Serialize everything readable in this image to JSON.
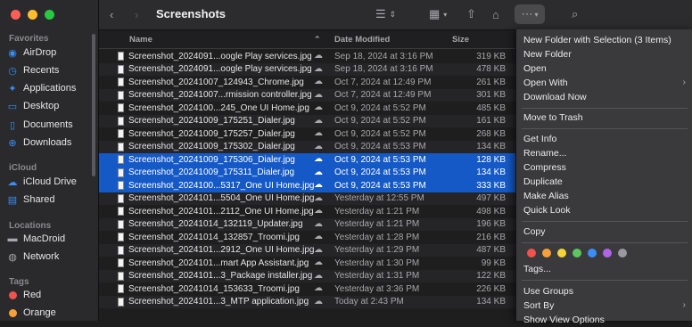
{
  "window": {
    "title": "Screenshots"
  },
  "sidebar": {
    "favorites_label": "Favorites",
    "favorites": [
      "AirDrop",
      "Recents",
      "Applications",
      "Desktop",
      "Documents",
      "Downloads"
    ],
    "icloud_label": "iCloud",
    "icloud": [
      "iCloud Drive",
      "Shared"
    ],
    "locations_label": "Locations",
    "locations": [
      "MacDroid",
      "Network"
    ],
    "tags_label": "Tags",
    "tags": [
      {
        "label": "Red",
        "color": "#f0524f"
      },
      {
        "label": "Orange",
        "color": "#f7a03a"
      }
    ]
  },
  "columns": {
    "name": "Name",
    "date": "Date Modified",
    "size": "Size"
  },
  "files": [
    {
      "name": "Screenshot_2024091...oogle Play services.jpg",
      "date": "Sep 18, 2024 at 3:16 PM",
      "size": "319 KB",
      "selected": false
    },
    {
      "name": "Screenshot_2024091...oogle Play services.jpg",
      "date": "Sep 18, 2024 at 3:16 PM",
      "size": "478 KB",
      "selected": false
    },
    {
      "name": "Screenshot_20241007_124943_Chrome.jpg",
      "date": "Oct 7, 2024 at 12:49 PM",
      "size": "261 KB",
      "selected": false
    },
    {
      "name": "Screenshot_20241007...rmission controller.jpg",
      "date": "Oct 7, 2024 at 12:49 PM",
      "size": "301 KB",
      "selected": false
    },
    {
      "name": "Screenshot_2024100...245_One UI Home.jpg",
      "date": "Oct 9, 2024 at 5:52 PM",
      "size": "485 KB",
      "selected": false
    },
    {
      "name": "Screenshot_20241009_175251_Dialer.jpg",
      "date": "Oct 9, 2024 at 5:52 PM",
      "size": "161 KB",
      "selected": false
    },
    {
      "name": "Screenshot_20241009_175257_Dialer.jpg",
      "date": "Oct 9, 2024 at 5:52 PM",
      "size": "268 KB",
      "selected": false
    },
    {
      "name": "Screenshot_20241009_175302_Dialer.jpg",
      "date": "Oct 9, 2024 at 5:53 PM",
      "size": "134 KB",
      "selected": false
    },
    {
      "name": "Screenshot_20241009_175306_Dialer.jpg",
      "date": "Oct 9, 2024 at 5:53 PM",
      "size": "128 KB",
      "selected": true
    },
    {
      "name": "Screenshot_20241009_175311_Dialer.jpg",
      "date": "Oct 9, 2024 at 5:53 PM",
      "size": "134 KB",
      "selected": true
    },
    {
      "name": "Screenshot_2024100...5317_One UI Home.jpg",
      "date": "Oct 9, 2024 at 5:53 PM",
      "size": "333 KB",
      "selected": true
    },
    {
      "name": "Screenshot_2024101...5504_One UI Home.jpg",
      "date": "Yesterday at 12:55 PM",
      "size": "497 KB",
      "selected": false
    },
    {
      "name": "Screenshot_2024101...2112_One UI Home.jpg",
      "date": "Yesterday at 1:21 PM",
      "size": "498 KB",
      "selected": false
    },
    {
      "name": "Screenshot_20241014_132119_Updater.jpg",
      "date": "Yesterday at 1:21 PM",
      "size": "196 KB",
      "selected": false
    },
    {
      "name": "Screenshot_20241014_132857_Troomi.jpg",
      "date": "Yesterday at 1:28 PM",
      "size": "216 KB",
      "selected": false
    },
    {
      "name": "Screenshot_2024101...2912_One UI Home.jpg",
      "date": "Yesterday at 1:29 PM",
      "size": "487 KB",
      "selected": false
    },
    {
      "name": "Screenshot_2024101...mart App Assistant.jpg",
      "date": "Yesterday at 1:30 PM",
      "size": "99 KB",
      "selected": false
    },
    {
      "name": "Screenshot_2024101...3_Package installer.jpg",
      "date": "Yesterday at 1:31 PM",
      "size": "122 KB",
      "selected": false
    },
    {
      "name": "Screenshot_20241014_153633_Troomi.jpg",
      "date": "Yesterday at 3:36 PM",
      "size": "226 KB",
      "selected": false
    },
    {
      "name": "Screenshot_2024101...3_MTP application.jpg",
      "date": "Today at 2:43 PM",
      "size": "134 KB",
      "selected": false
    }
  ],
  "menu": {
    "new_folder_with_selection": "New Folder with Selection (3 Items)",
    "new_folder": "New Folder",
    "open": "Open",
    "open_with": "Open With",
    "download_now": "Download Now",
    "move_to_trash": "Move to Trash",
    "get_info": "Get Info",
    "rename": "Rename...",
    "compress": "Compress",
    "duplicate": "Duplicate",
    "make_alias": "Make Alias",
    "quick_look": "Quick Look",
    "copy": "Copy",
    "tags": "Tags...",
    "use_groups": "Use Groups",
    "sort_by": "Sort By",
    "show_view_options": "Show View Options",
    "tag_colors": [
      "#f0524f",
      "#f7a03a",
      "#f5d33b",
      "#5dc45f",
      "#3b8ef6",
      "#b065e6",
      "#9a9a9e"
    ]
  }
}
